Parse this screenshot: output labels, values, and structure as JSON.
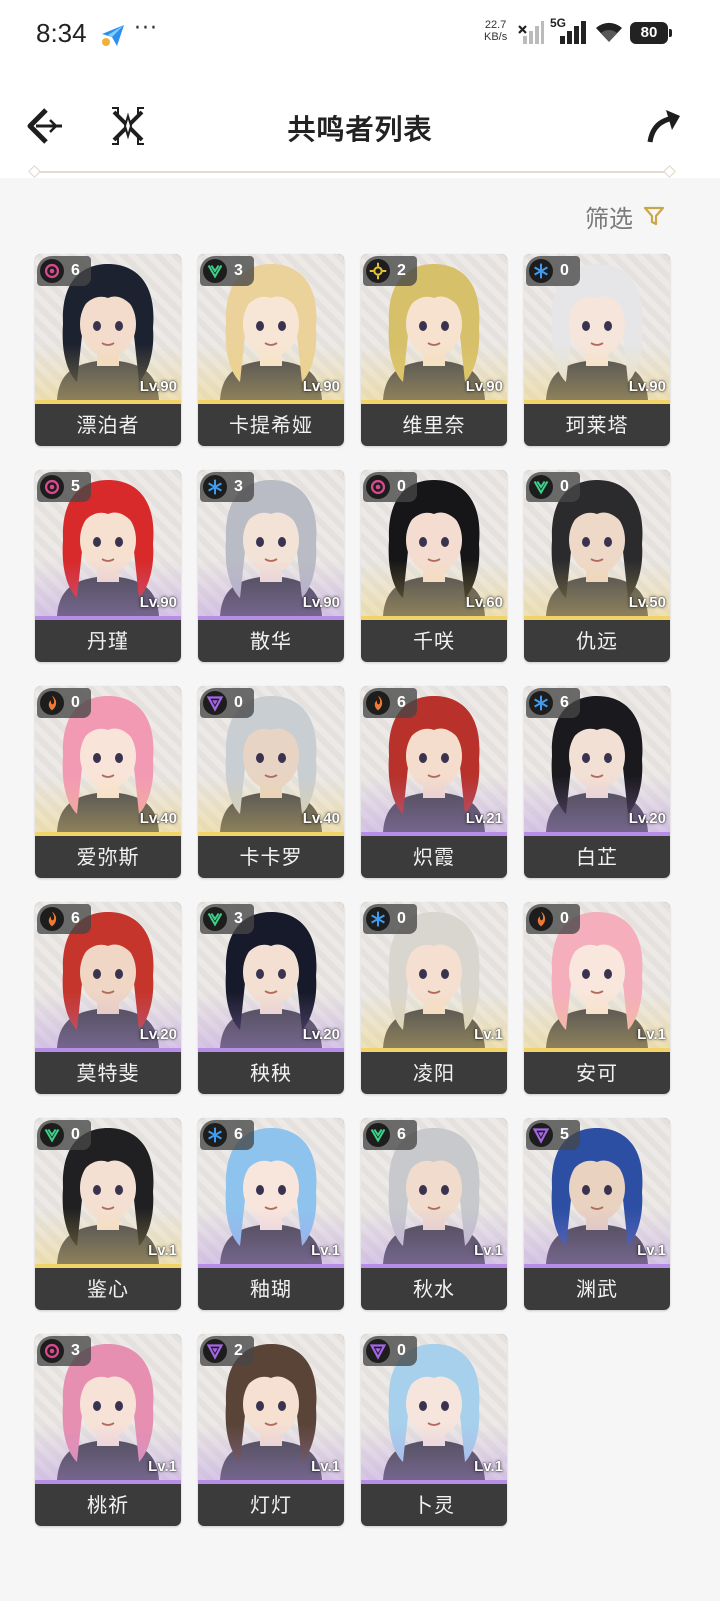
{
  "status_bar": {
    "time": "8:34",
    "more": "···",
    "net_speed_value": "22.7",
    "net_speed_unit": "KB/s",
    "network": "5G",
    "battery": "80"
  },
  "header": {
    "title": "共鸣者列表",
    "back_icon": "back-arrow-icon",
    "cross_icon": "crossed-swords-icon",
    "share_icon": "share-arrow-icon"
  },
  "filter": {
    "label": "筛选",
    "icon": "funnel-icon",
    "color": "#c9a64a"
  },
  "colors": {
    "five_star": "#f1d36a",
    "four_star": "#b68ee6",
    "spectro": "#e4c23b",
    "aero": "#3ed18a",
    "glacio": "#3f9cf0",
    "fusion": "#f07a34",
    "electro": "#a465e6",
    "havoc": "#d64a8e"
  },
  "resonators": [
    {
      "name": "漂泊者",
      "level": "Lv.90",
      "chain": "6",
      "element": "havoc",
      "rarity": 5,
      "hair": "#1d2230",
      "skin": "#f3dccb"
    },
    {
      "name": "卡提希娅",
      "level": "Lv.90",
      "chain": "3",
      "element": "aero",
      "rarity": 5,
      "hair": "#ead29a",
      "skin": "#f7e6d6"
    },
    {
      "name": "维里奈",
      "level": "Lv.90",
      "chain": "2",
      "element": "spectro",
      "rarity": 5,
      "hair": "#d7c06a",
      "skin": "#f6e2cf"
    },
    {
      "name": "珂莱塔",
      "level": "Lv.90",
      "chain": "0",
      "element": "glacio",
      "rarity": 5,
      "hair": "#e6e6e8",
      "skin": "#f6e5db"
    },
    {
      "name": "丹瑾",
      "level": "Lv.90",
      "chain": "5",
      "element": "havoc",
      "rarity": 4,
      "hair": "#d82a2a",
      "skin": "#f6e0d0"
    },
    {
      "name": "散华",
      "level": "Lv.90",
      "chain": "3",
      "element": "glacio",
      "rarity": 4,
      "hair": "#b9bcc4",
      "skin": "#f3e2d6"
    },
    {
      "name": "千咲",
      "level": "Lv.60",
      "chain": "0",
      "element": "havoc",
      "rarity": 5,
      "hair": "#161618",
      "skin": "#f4ddd0"
    },
    {
      "name": "仇远",
      "level": "Lv.50",
      "chain": "0",
      "element": "aero",
      "rarity": 5,
      "hair": "#2b2b2e",
      "skin": "#eed8c8"
    },
    {
      "name": "爱弥斯",
      "level": "Lv.40",
      "chain": "0",
      "element": "fusion",
      "rarity": 5,
      "hair": "#f29ab4",
      "skin": "#f8e4d8"
    },
    {
      "name": "卡卡罗",
      "level": "Lv.40",
      "chain": "0",
      "element": "electro",
      "rarity": 5,
      "hair": "#c9ced3",
      "skin": "#e8d4c4"
    },
    {
      "name": "炽霞",
      "level": "Lv.21",
      "chain": "6",
      "element": "fusion",
      "rarity": 4,
      "hair": "#b8322b",
      "skin": "#f4ddcd"
    },
    {
      "name": "白芷",
      "level": "Lv.20",
      "chain": "6",
      "element": "glacio",
      "rarity": 4,
      "hair": "#1a1a1e",
      "skin": "#f3e0d4"
    },
    {
      "name": "莫特斐",
      "level": "Lv.20",
      "chain": "6",
      "element": "fusion",
      "rarity": 4,
      "hair": "#c5352c",
      "skin": "#f0d6c4"
    },
    {
      "name": "秧秧",
      "level": "Lv.20",
      "chain": "3",
      "element": "aero",
      "rarity": 4,
      "hair": "#171a2a",
      "skin": "#f4e0d2"
    },
    {
      "name": "凌阳",
      "level": "Lv.1",
      "chain": "0",
      "element": "glacio",
      "rarity": 5,
      "hair": "#d9d6cf",
      "skin": "#f4dfd0"
    },
    {
      "name": "安可",
      "level": "Lv.1",
      "chain": "0",
      "element": "fusion",
      "rarity": 5,
      "hair": "#f4aebc",
      "skin": "#f9e6dc"
    },
    {
      "name": "鉴心",
      "level": "Lv.1",
      "chain": "0",
      "element": "aero",
      "rarity": 5,
      "hair": "#202022",
      "skin": "#f4e0d2"
    },
    {
      "name": "釉瑚",
      "level": "Lv.1",
      "chain": "6",
      "element": "glacio",
      "rarity": 4,
      "hair": "#8ec3ee",
      "skin": "#f8e6dc"
    },
    {
      "name": "秋水",
      "level": "Lv.1",
      "chain": "6",
      "element": "aero",
      "rarity": 4,
      "hair": "#c7c9cc",
      "skin": "#f0dbcc"
    },
    {
      "name": "渊武",
      "level": "Lv.1",
      "chain": "5",
      "element": "electro",
      "rarity": 4,
      "hair": "#2c4fa3",
      "skin": "#e9d2c0"
    },
    {
      "name": "桃祈",
      "level": "Lv.1",
      "chain": "3",
      "element": "havoc",
      "rarity": 4,
      "hair": "#e78fb0",
      "skin": "#f7e2d8"
    },
    {
      "name": "灯灯",
      "level": "Lv.1",
      "chain": "2",
      "element": "electro",
      "rarity": 4,
      "hair": "#5a4438",
      "skin": "#f5e0d2"
    },
    {
      "name": "卜灵",
      "level": "Lv.1",
      "chain": "0",
      "element": "electro",
      "rarity": 4,
      "hair": "#a6d0ec",
      "skin": "#f6e5dc"
    }
  ]
}
